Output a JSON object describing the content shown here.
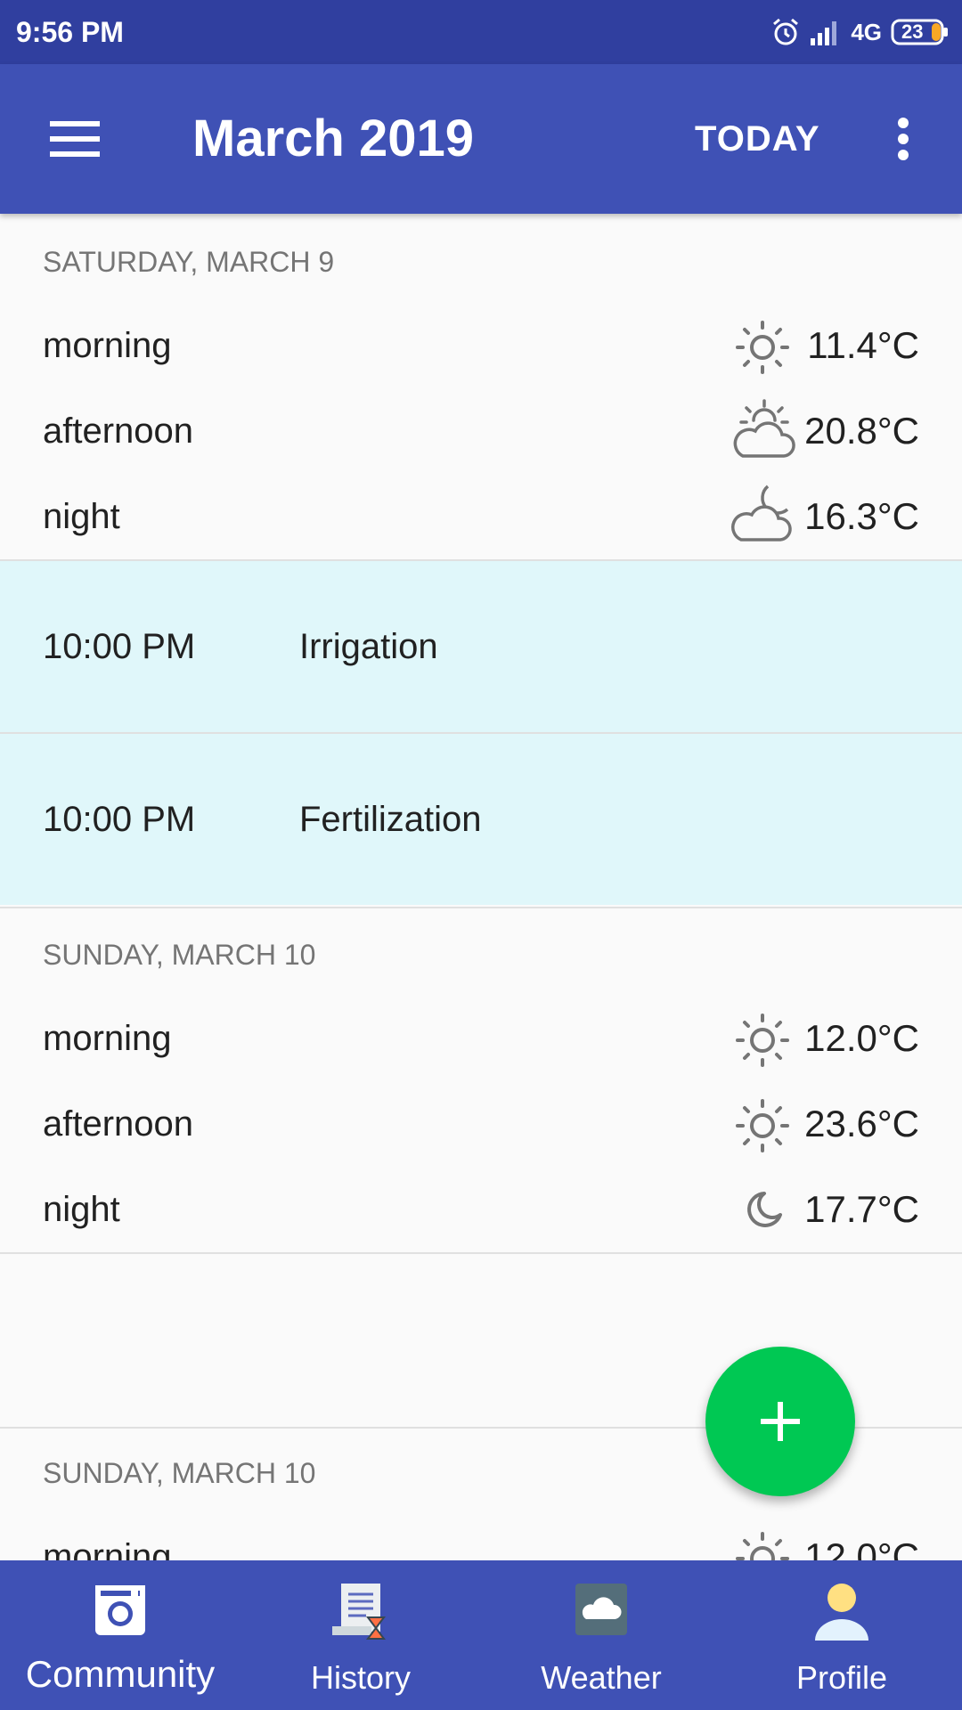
{
  "status_bar": {
    "time": "9:56 PM",
    "network": "4G",
    "battery": "23"
  },
  "app_bar": {
    "title": "March 2019",
    "today_label": "TODAY"
  },
  "days": [
    {
      "header": "SATURDAY, MARCH 9",
      "periods": [
        {
          "label": "morning",
          "icon": "sun-icon",
          "temp": "11.4°C"
        },
        {
          "label": "afternoon",
          "icon": "sun-cloud-icon",
          "temp": "20.8°C"
        },
        {
          "label": "night",
          "icon": "moon-cloud-icon",
          "temp": "16.3°C"
        }
      ],
      "events": [
        {
          "time": "10:00 PM",
          "title": "Irrigation"
        },
        {
          "time": "10:00 PM",
          "title": "Fertilization"
        }
      ]
    },
    {
      "header": "SUNDAY, MARCH 10",
      "periods": [
        {
          "label": "morning",
          "icon": "sun-icon",
          "temp": "12.0°C"
        },
        {
          "label": "afternoon",
          "icon": "sun-icon",
          "temp": "23.6°C"
        },
        {
          "label": "night",
          "icon": "moon-icon",
          "temp": "17.7°C"
        }
      ]
    },
    {
      "header": "SUNDAY, MARCH 10",
      "periods": [
        {
          "label": "morning",
          "icon": "sun-icon",
          "temp": "12.0°C"
        }
      ]
    }
  ],
  "bottom_nav": [
    {
      "label": "Community",
      "icon": "camera-icon"
    },
    {
      "label": "History",
      "icon": "history-icon"
    },
    {
      "label": "Weather",
      "icon": "cloud-icon"
    },
    {
      "label": "Profile",
      "icon": "profile-icon"
    }
  ],
  "colors": {
    "status_bar": "#303f9f",
    "app_bar": "#3f51b5",
    "event_bg": "#e0f7fa",
    "fab": "#00c853",
    "day_header": "#757575"
  }
}
